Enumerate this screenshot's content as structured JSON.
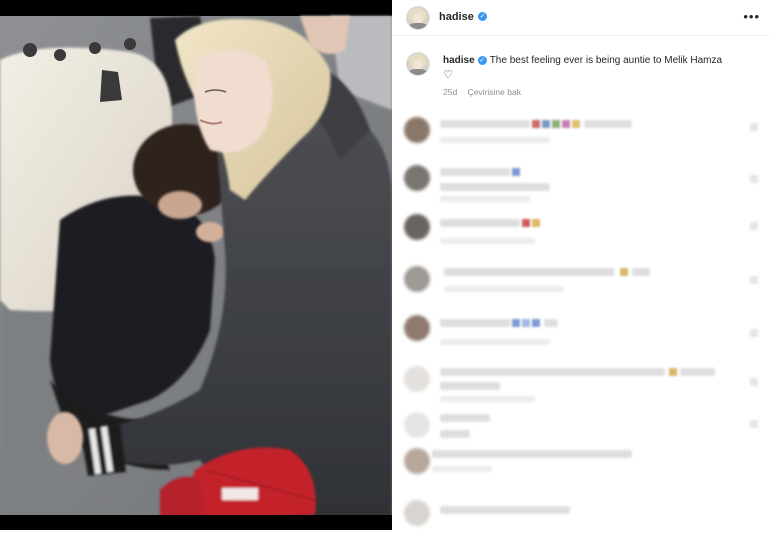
{
  "post": {
    "username": "hadise",
    "verified_mark": "✓",
    "more_label": "•••",
    "caption_text": "The best feeling ever is being auntie to Melik Hamza",
    "caption_heart": "♡",
    "age": "25d",
    "translate_label": "Çevirisine bak"
  },
  "colors": {
    "verified_blue": "#3897f0",
    "text_primary": "#262626",
    "text_secondary": "#8e8e8e"
  },
  "icons": {
    "verified": "verified-badge-icon",
    "more": "more-options-icon",
    "heart": "heart-icon"
  }
}
